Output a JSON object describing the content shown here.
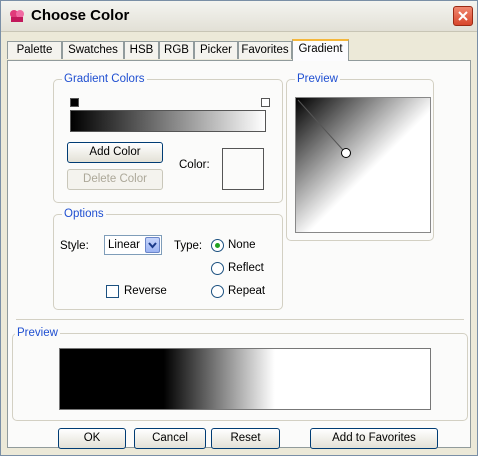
{
  "window": {
    "title": "Choose Color"
  },
  "tabs": [
    {
      "label": "Palette"
    },
    {
      "label": "Swatches"
    },
    {
      "label": "HSB"
    },
    {
      "label": "RGB"
    },
    {
      "label": "Picker"
    },
    {
      "label": "Favorites"
    },
    {
      "label": "Gradient",
      "active": true
    }
  ],
  "gradient_colors": {
    "title": "Gradient Colors",
    "add_color": "Add Color",
    "delete_color": "Delete Color",
    "color_label": "Color:"
  },
  "preview_small": {
    "title": "Preview"
  },
  "options": {
    "title": "Options",
    "style_label": "Style:",
    "style_value": "Linear",
    "type_label": "Type:",
    "type_options": [
      "None",
      "Reflect",
      "Repeat"
    ],
    "type_selected": "None",
    "reverse_label": "Reverse",
    "reverse_checked": false
  },
  "preview_large": {
    "title": "Preview"
  },
  "buttons": {
    "ok": "OK",
    "cancel": "Cancel",
    "reset": "Reset",
    "add_to_favorites": "Add to Favorites"
  },
  "colors": {
    "accent_title": "#1f4fd1",
    "tab_active_border": "#f5b73a",
    "gradient_start": "#000000",
    "gradient_end": "#ffffff",
    "close_button": "#d8462b"
  },
  "icons": {
    "app": "color-palette-icon",
    "close": "close-icon",
    "dropdown": "chevron-down-icon"
  }
}
